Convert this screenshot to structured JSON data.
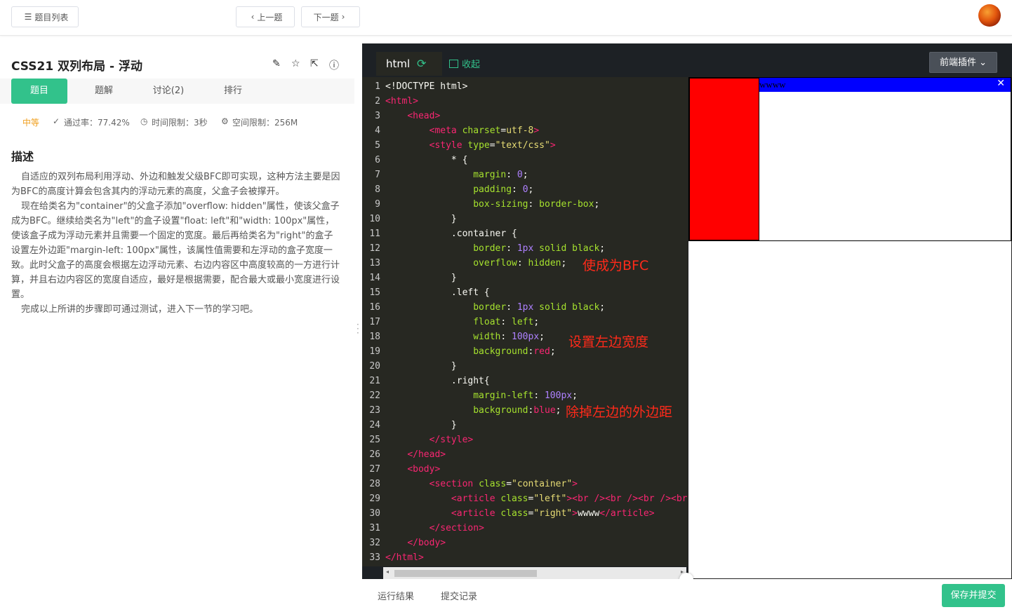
{
  "topbar": {
    "list_button": "题目列表",
    "prev_button": "上一题",
    "next_button": "下一题"
  },
  "problem": {
    "title": "CSS21  双列布局 - 浮动",
    "tabs": [
      "题目",
      "题解",
      "讨论(2)",
      "排行"
    ],
    "difficulty": "中等",
    "pass_rate": "通过率：77.42%",
    "time_limit": "时间限制：3秒",
    "memory_limit": "空间限制：256M",
    "desc_title": "描述",
    "desc_paragraphs": [
      "自适应的双列布局利用浮动、外边和触发父级BFC即可实现，这种方法主要是因为BFC的高度计算会包含其内的浮动元素的高度，父盒子会被撑开。",
      "现在给类名为\"container\"的父盒子添加\"overflow: hidden\"属性，使该父盒子成为BFC。继续给类名为\"left\"的盒子设置\"float: left\"和\"width: 100px\"属性，使该盒子成为浮动元素并且需要一个固定的宽度。最后再给类名为\"right\"的盒子设置左外边距\"margin-left: 100px\"属性，该属性值需要和左浮动的盒子宽度一致。此时父盒子的高度会根据左边浮动元素、右边内容区中高度较高的一方进行计算，并且右边内容区的宽度自适应，最好是根据需要，配合最大或最小宽度进行设置。",
      "完成以上所讲的步骤即可通过测试，进入下一节的学习吧。"
    ]
  },
  "editor": {
    "tab_label": "html",
    "collapse_label": "收起",
    "plugin_label": "前端插件",
    "annotations": [
      "使成为BFC",
      "设置左边宽度",
      "除掉左边的外边距"
    ],
    "lines": [
      [
        {
          "c": "p",
          "t": "<!DOCTYPE html>"
        }
      ],
      [
        {
          "c": "t",
          "t": "<html>"
        }
      ],
      [
        {
          "c": "p",
          "t": "    "
        },
        {
          "c": "t",
          "t": "<head>"
        }
      ],
      [
        {
          "c": "p",
          "t": "        "
        },
        {
          "c": "t",
          "t": "<meta "
        },
        {
          "c": "a",
          "t": "charset"
        },
        {
          "c": "p",
          "t": "="
        },
        {
          "c": "s",
          "t": "utf-8"
        },
        {
          "c": "t",
          "t": ">"
        }
      ],
      [
        {
          "c": "p",
          "t": "        "
        },
        {
          "c": "t",
          "t": "<style "
        },
        {
          "c": "a",
          "t": "type"
        },
        {
          "c": "p",
          "t": "="
        },
        {
          "c": "s",
          "t": "\"text/css\""
        },
        {
          "c": "t",
          "t": ">"
        }
      ],
      [
        {
          "c": "p",
          "t": "            * {"
        }
      ],
      [
        {
          "c": "p",
          "t": "                "
        },
        {
          "c": "a",
          "t": "margin"
        },
        {
          "c": "p",
          "t": ": "
        },
        {
          "c": "n",
          "t": "0"
        },
        {
          "c": "p",
          "t": ";"
        }
      ],
      [
        {
          "c": "p",
          "t": "                "
        },
        {
          "c": "a",
          "t": "padding"
        },
        {
          "c": "p",
          "t": ": "
        },
        {
          "c": "n",
          "t": "0"
        },
        {
          "c": "p",
          "t": ";"
        }
      ],
      [
        {
          "c": "p",
          "t": "                "
        },
        {
          "c": "a",
          "t": "box-sizing"
        },
        {
          "c": "p",
          "t": ": "
        },
        {
          "c": "a",
          "t": "border-box"
        },
        {
          "c": "p",
          "t": ";"
        }
      ],
      [
        {
          "c": "p",
          "t": "            }"
        }
      ],
      [
        {
          "c": "p",
          "t": "            .container {"
        }
      ],
      [
        {
          "c": "p",
          "t": "                "
        },
        {
          "c": "a",
          "t": "border"
        },
        {
          "c": "p",
          "t": ": "
        },
        {
          "c": "n",
          "t": "1px"
        },
        {
          "c": "p",
          "t": " "
        },
        {
          "c": "a",
          "t": "solid black"
        },
        {
          "c": "p",
          "t": ";"
        }
      ],
      [
        {
          "c": "p",
          "t": "                "
        },
        {
          "c": "a",
          "t": "overflow"
        },
        {
          "c": "p",
          "t": ": "
        },
        {
          "c": "a",
          "t": "hidden"
        },
        {
          "c": "p",
          "t": ";"
        }
      ],
      [
        {
          "c": "p",
          "t": "            }"
        }
      ],
      [
        {
          "c": "p",
          "t": "            .left {"
        }
      ],
      [
        {
          "c": "p",
          "t": "                "
        },
        {
          "c": "a",
          "t": "border"
        },
        {
          "c": "p",
          "t": ": "
        },
        {
          "c": "n",
          "t": "1px"
        },
        {
          "c": "p",
          "t": " "
        },
        {
          "c": "a",
          "t": "solid black"
        },
        {
          "c": "p",
          "t": ";"
        }
      ],
      [
        {
          "c": "p",
          "t": "                "
        },
        {
          "c": "a",
          "t": "float"
        },
        {
          "c": "p",
          "t": ": "
        },
        {
          "c": "a",
          "t": "left"
        },
        {
          "c": "p",
          "t": ";"
        }
      ],
      [
        {
          "c": "p",
          "t": "                "
        },
        {
          "c": "a",
          "t": "width"
        },
        {
          "c": "p",
          "t": ": "
        },
        {
          "c": "n",
          "t": "100px"
        },
        {
          "c": "p",
          "t": ";"
        }
      ],
      [
        {
          "c": "p",
          "t": "                "
        },
        {
          "c": "a",
          "t": "background"
        },
        {
          "c": "p",
          "t": ":"
        },
        {
          "c": "t",
          "t": "red"
        },
        {
          "c": "p",
          "t": ";"
        }
      ],
      [
        {
          "c": "p",
          "t": "            }"
        }
      ],
      [
        {
          "c": "p",
          "t": "            .right{"
        }
      ],
      [
        {
          "c": "p",
          "t": "                "
        },
        {
          "c": "a",
          "t": "margin-left"
        },
        {
          "c": "p",
          "t": ": "
        },
        {
          "c": "n",
          "t": "100px"
        },
        {
          "c": "p",
          "t": ";"
        }
      ],
      [
        {
          "c": "p",
          "t": "                "
        },
        {
          "c": "a",
          "t": "background"
        },
        {
          "c": "p",
          "t": ":"
        },
        {
          "c": "t",
          "t": "blue"
        },
        {
          "c": "p",
          "t": ";"
        }
      ],
      [
        {
          "c": "p",
          "t": "            }"
        }
      ],
      [
        {
          "c": "p",
          "t": "        "
        },
        {
          "c": "t",
          "t": "</style>"
        }
      ],
      [
        {
          "c": "p",
          "t": "    "
        },
        {
          "c": "t",
          "t": "</head>"
        }
      ],
      [
        {
          "c": "p",
          "t": "    "
        },
        {
          "c": "t",
          "t": "<body>"
        }
      ],
      [
        {
          "c": "p",
          "t": "        "
        },
        {
          "c": "t",
          "t": "<section "
        },
        {
          "c": "a",
          "t": "class"
        },
        {
          "c": "p",
          "t": "="
        },
        {
          "c": "s",
          "t": "\"container\""
        },
        {
          "c": "t",
          "t": ">"
        }
      ],
      [
        {
          "c": "p",
          "t": "            "
        },
        {
          "c": "t",
          "t": "<article "
        },
        {
          "c": "a",
          "t": "class"
        },
        {
          "c": "p",
          "t": "="
        },
        {
          "c": "s",
          "t": "\"left\""
        },
        {
          "c": "t",
          "t": "><br /><br /><br /><br"
        }
      ],
      [
        {
          "c": "p",
          "t": "            "
        },
        {
          "c": "t",
          "t": "<article "
        },
        {
          "c": "a",
          "t": "class"
        },
        {
          "c": "p",
          "t": "="
        },
        {
          "c": "s",
          "t": "\"right\""
        },
        {
          "c": "t",
          "t": ">"
        },
        {
          "c": "p",
          "t": "wwww"
        },
        {
          "c": "t",
          "t": "</article>"
        }
      ],
      [
        {
          "c": "p",
          "t": "        "
        },
        {
          "c": "t",
          "t": "</section>"
        }
      ],
      [
        {
          "c": "p",
          "t": "    "
        },
        {
          "c": "t",
          "t": "</body>"
        }
      ],
      [
        {
          "c": "t",
          "t": "</html>"
        }
      ]
    ]
  },
  "preview": {
    "right_text": "wwww"
  },
  "bottom": {
    "run_result": "运行结果",
    "submit_records": "提交记录",
    "submit_button": "保存并提交"
  }
}
